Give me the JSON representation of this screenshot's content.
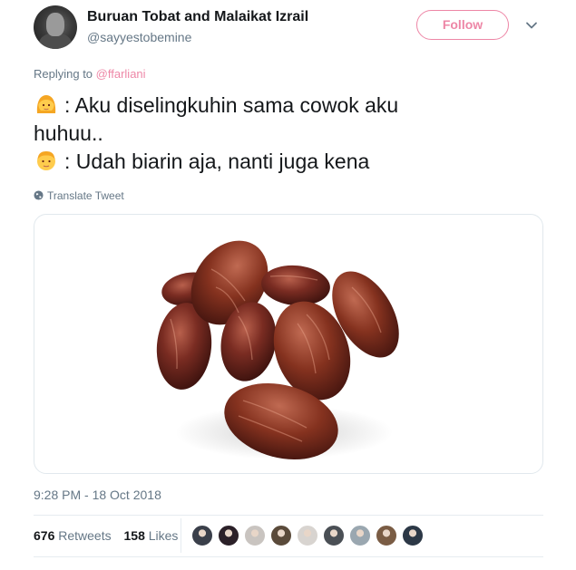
{
  "user": {
    "display_name": "Buruan Tobat and Malaikat Izrail",
    "handle": "@sayyestobemine",
    "avatar_icon": "profile-photo"
  },
  "follow_button": {
    "label": "Follow"
  },
  "menu_icon": "chevron-down-icon",
  "replying": {
    "prefix": "Replying to",
    "mention": "@ffarliani"
  },
  "tweet": {
    "lines": [
      {
        "emoji": "woman-emoji",
        "text": ": Aku diselingkuhin sama cowok aku"
      },
      {
        "emoji": "",
        "text": "huhuu.."
      },
      {
        "emoji": "man-emoji",
        "text": ": Udah biarin aja, nanti juga kena"
      }
    ]
  },
  "translate": {
    "label": "Translate Tweet",
    "icon": "globe-icon"
  },
  "media": {
    "description_icon": "dates-fruit-image"
  },
  "timestamp": "9:28 PM - 18 Oct 2018",
  "stats": {
    "retweets_count": "676",
    "retweets_label": "Retweets",
    "likes_count": "158",
    "likes_label": "Likes"
  },
  "liker_avatars": [
    {
      "name": "liker-avatar-1",
      "color": "#3a3f4a"
    },
    {
      "name": "liker-avatar-2",
      "color": "#2b2028"
    },
    {
      "name": "liker-avatar-3",
      "color": "#c9c4c0"
    },
    {
      "name": "liker-avatar-4",
      "color": "#5a4a3a"
    },
    {
      "name": "liker-avatar-5",
      "color": "#d8d4d0"
    },
    {
      "name": "liker-avatar-6",
      "color": "#4a4f55"
    },
    {
      "name": "liker-avatar-7",
      "color": "#9aa7b0"
    },
    {
      "name": "liker-avatar-8",
      "color": "#7a5c44"
    },
    {
      "name": "liker-avatar-9",
      "color": "#2c3846"
    }
  ],
  "colors": {
    "accent": "#e0245e",
    "secondary_text": "#657786",
    "primary_text": "#14171a",
    "border": "#e1e8ed"
  }
}
